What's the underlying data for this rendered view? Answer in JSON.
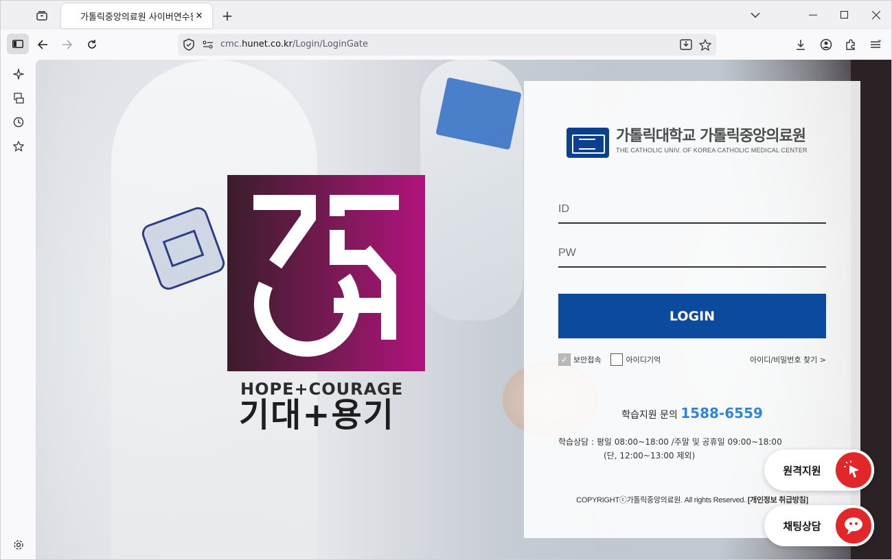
{
  "browser": {
    "tab_title": "가톨릭중앙의료원 사이버연수원",
    "new_tab": "+",
    "url_prefix": "cmc.",
    "url_domain": "hunet.co.kr",
    "url_path": "/Login/LoginGate"
  },
  "page": {
    "hero": {
      "slogan_en": "HOPE+COURAGE",
      "slogan_ko": "기대+용기"
    },
    "logo": {
      "name_ko": "가톨릭대학교 가톨릭중앙의료원",
      "name_en": "THE CATHOLIC UNIV. OF KOREA CATHOLIC MEDICAL CENTER"
    },
    "login": {
      "id_placeholder": "ID",
      "pw_placeholder": "PW",
      "button": "LOGIN",
      "secure_label": "보안접속",
      "secure_checked": true,
      "remember_label": "아이디기억",
      "remember_checked": false,
      "find_link": "아이디/비밀번호 찾기 >"
    },
    "support": {
      "label": "학습지원 문의",
      "phone": "1588-6559",
      "hours_line1": "학습상담 :  평일 08:00~18:00 /주말 및 공휴일 09:00~18:00",
      "hours_line2": "(단, 12:00~13:00 제외)"
    },
    "footer": {
      "copyright": "COPYRIGHTⓒ가톨릭중앙의료원. All rights Reserved.",
      "privacy": "[개인정보 취급방침]"
    },
    "floating": {
      "remote_support": "원격지원",
      "chat": "채팅상담"
    }
  },
  "colors": {
    "login_button": "#0b4a9c",
    "phone": "#2f86d9",
    "float_icon": "#e3262a",
    "badge_start": "#3b1c2a",
    "badge_end": "#b2127c"
  }
}
